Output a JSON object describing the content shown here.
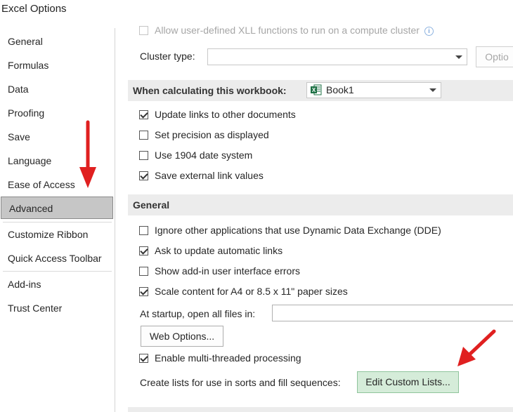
{
  "window": {
    "title": "Excel Options"
  },
  "sidebar": {
    "items": [
      {
        "label": "General"
      },
      {
        "label": "Formulas"
      },
      {
        "label": "Data"
      },
      {
        "label": "Proofing"
      },
      {
        "label": "Save"
      },
      {
        "label": "Language"
      },
      {
        "label": "Ease of Access"
      },
      {
        "label": "Advanced",
        "selected": true
      },
      {
        "label": "Customize Ribbon"
      },
      {
        "label": "Quick Access Toolbar"
      },
      {
        "label": "Add-ins"
      },
      {
        "label": "Trust Center"
      }
    ]
  },
  "top_partial": {
    "xll_option": {
      "label": "Allow user-defined XLL functions to run on a compute cluster",
      "checked": false,
      "info_icon": "info-icon"
    },
    "cluster_type_label": "Cluster type:",
    "cluster_type_value": "",
    "options_button": "Optio"
  },
  "workbook_section": {
    "header": "When calculating this workbook:",
    "workbook_select": "Book1",
    "options": [
      {
        "label": "Update links to other documents",
        "checked": true
      },
      {
        "label": "Set precision as displayed",
        "checked": false
      },
      {
        "label": "Use 1904 date system",
        "checked": false
      },
      {
        "label": "Save external link values",
        "checked": true
      }
    ]
  },
  "general_section": {
    "header": "General",
    "options": [
      {
        "label": "Ignore other applications that use Dynamic Data Exchange (DDE)",
        "checked": false
      },
      {
        "label": "Ask to update automatic links",
        "checked": true
      },
      {
        "label": "Show add-in user interface errors",
        "checked": false
      },
      {
        "label": "Scale content for A4 or 8.5 x 11\" paper sizes",
        "checked": true
      }
    ],
    "startup_label": "At startup, open all files in:",
    "startup_value": "",
    "web_options_button": "Web Options...",
    "multithreaded": {
      "label": "Enable multi-threaded processing",
      "checked": true
    },
    "custom_lists_label": "Create lists for use in sorts and fill sequences:",
    "edit_custom_lists_button": "Edit Custom Lists..."
  },
  "colors": {
    "annotation_arrow": "#e02020",
    "selected_bg": "#c6c6c6",
    "highlight_button": "#d5ecd9",
    "excel_green": "#1e7145"
  }
}
